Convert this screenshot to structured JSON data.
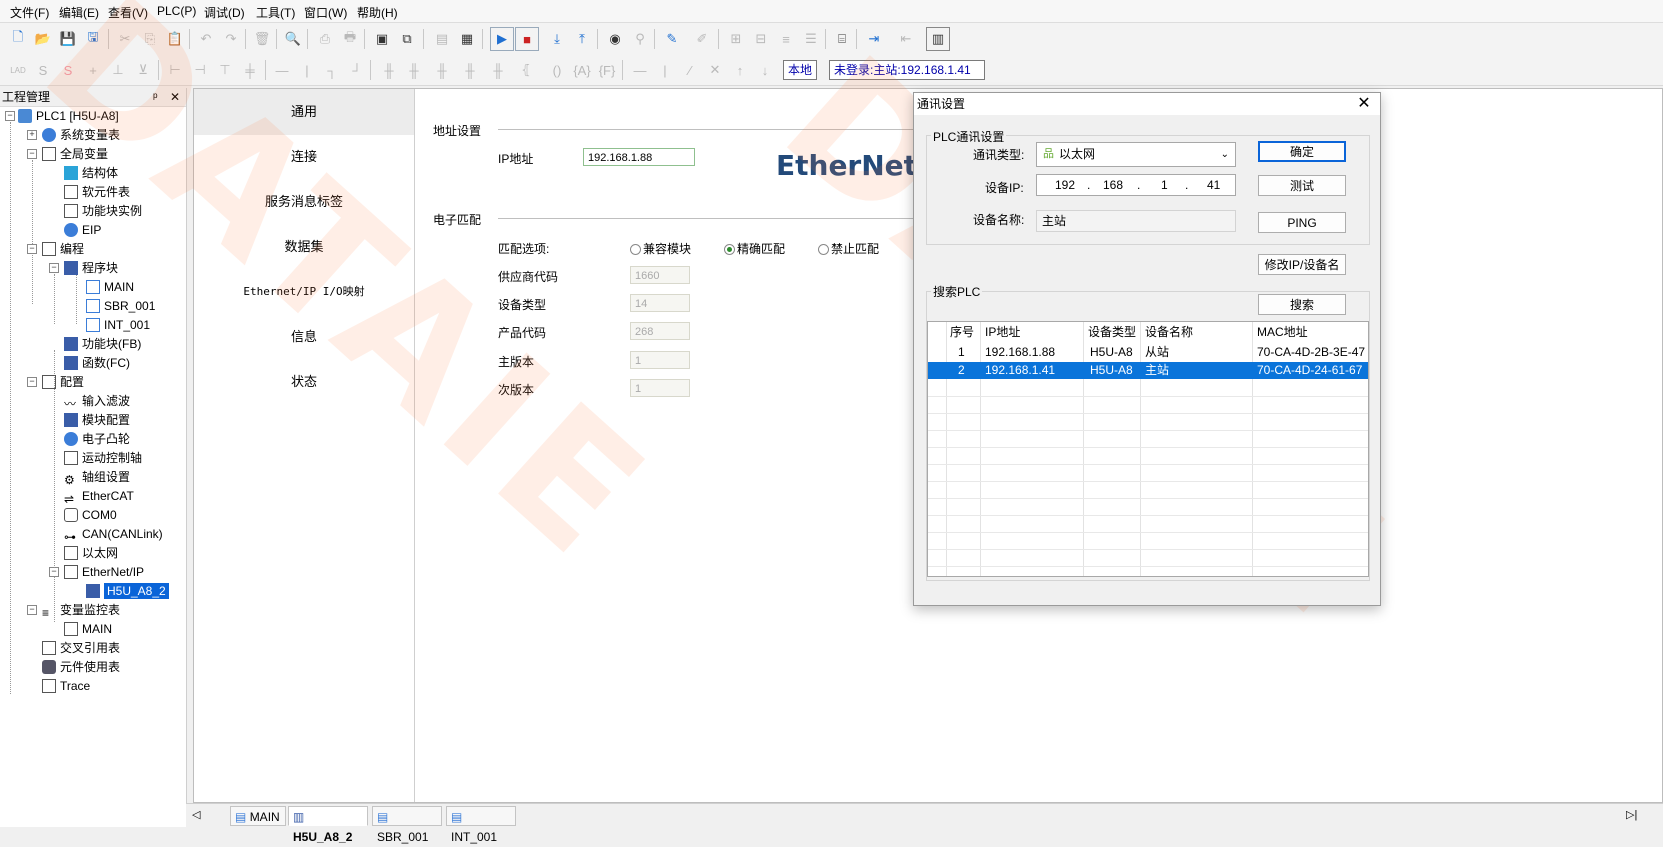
{
  "menu": [
    "文件(F)",
    "编辑(E)",
    "查看(V)",
    "PLC(P)",
    "调试(D)",
    "工具(T)",
    "窗口(W)",
    "帮助(H)"
  ],
  "toolbar": {
    "local_label": "本地",
    "login_status": "未登录:主站:192.168.1.41"
  },
  "project": {
    "title": "工程管理",
    "pin": "ᵖ",
    "close": "✕",
    "nodes": {
      "plc": "PLC1 [H5U-A8]",
      "sysvar": "系统变量表",
      "globalvar": "全局变量",
      "struct": "结构体",
      "softelem": "软元件表",
      "fbinst": "功能块实例",
      "eip": "EIP",
      "program": "编程",
      "progblock": "程序块",
      "main": "MAIN",
      "sbr": "SBR_001",
      "int": "INT_001",
      "fb": "功能块(FB)",
      "fc": "函数(FC)",
      "config": "配置",
      "input_filter": "输入滤波",
      "module_cfg": "模块配置",
      "ecam": "电子凸轮",
      "motion_axis": "运动控制轴",
      "axis_group": "轴组设置",
      "ethercat": "EtherCAT",
      "com0": "COM0",
      "can": "CAN(CANLink)",
      "ethernet": "以太网",
      "ethernetip": "EtherNet/IP",
      "h5u": "H5U_A8_2",
      "varmon": "变量监控表",
      "varmon_main": "MAIN",
      "crossref": "交叉引用表",
      "elemuse": "元件使用表",
      "trace": "Trace"
    }
  },
  "editor": {
    "nav": [
      "通用",
      "连接",
      "服务消息标签",
      "数据集",
      "Ethernet/IP I/O映射",
      "信息",
      "状态"
    ],
    "addr_section": "地址设置",
    "ip_label": "IP地址",
    "ip_value": "192.168.1.88",
    "logo_text": "EtherNet/I",
    "ekey_section": "电子匹配",
    "match_label": "匹配选项:",
    "radios": [
      "兼容模块",
      "精确匹配",
      "禁止匹配"
    ],
    "vendor_label": "供应商代码",
    "vendor_value": "1660",
    "devtype_label": "设备类型",
    "devtype_value": "14",
    "product_label": "产品代码",
    "product_value": "268",
    "major_label": "主版本",
    "major_value": "1",
    "minor_label": "次版本",
    "minor_value": "1"
  },
  "watermark": "DATAIE",
  "dialog": {
    "title": "通讯设置",
    "close": "✕",
    "plc_group": "PLC通讯设置",
    "comm_type_label": "通讯类型:",
    "comm_type_value": "以太网",
    "ip_label": "设备IP:",
    "ip_octets": [
      "192",
      "168",
      "1",
      "41"
    ],
    "dot": ".",
    "name_label": "设备名称:",
    "name_value": "主站",
    "btn_ok": "确定",
    "btn_test": "测试",
    "btn_ping": "PING",
    "btn_modify": "修改IP/设备名",
    "search_group": "搜索PLC",
    "btn_search": "搜索",
    "columns": [
      "序号",
      "IP地址",
      "设备类型",
      "设备名称",
      "MAC地址"
    ],
    "rows": [
      {
        "no": "1",
        "ip": "192.168.1.88",
        "type": "H5U-A8",
        "name": "从站",
        "mac": "70-CA-4D-2B-3E-47"
      },
      {
        "no": "2",
        "ip": "192.168.1.41",
        "type": "H5U-A8",
        "name": "主站",
        "mac": "70-CA-4D-24-61-67"
      }
    ]
  },
  "tabs": {
    "scroll_left": "◁",
    "items": [
      "MAIN",
      "H5U_A8_2",
      "SBR_001",
      "INT_001"
    ],
    "scroll_right": "▷|"
  },
  "colors": {
    "selection": "#0a74da",
    "accent": "#1f6fd1",
    "watermark": "#ff7840"
  }
}
